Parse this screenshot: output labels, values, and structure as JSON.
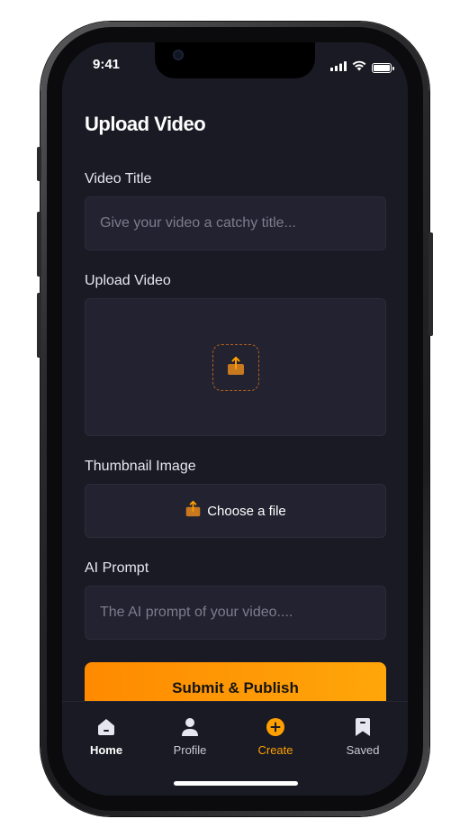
{
  "status_bar": {
    "time": "9:41",
    "signal_icon": "signal-bars-icon",
    "wifi_icon": "wifi-icon",
    "battery_icon": "battery-icon"
  },
  "page": {
    "title": "Upload Video"
  },
  "form": {
    "video_title": {
      "label": "Video Title",
      "placeholder": "Give your video a catchy title..."
    },
    "upload_video": {
      "label": "Upload Video",
      "icon": "upload-icon"
    },
    "thumbnail": {
      "label": "Thumbnail Image",
      "button_label": "Choose a file",
      "icon": "upload-icon"
    },
    "ai_prompt": {
      "label": "AI Prompt",
      "placeholder": "The AI prompt of your video...."
    },
    "submit_label": "Submit & Publish"
  },
  "tabs": [
    {
      "label": "Home",
      "icon": "home-icon",
      "active": false
    },
    {
      "label": "Profile",
      "icon": "profile-icon",
      "active": false
    },
    {
      "label": "Create",
      "icon": "plus-circle-icon",
      "active": true
    },
    {
      "label": "Saved",
      "icon": "bookmark-icon",
      "active": false
    }
  ],
  "colors": {
    "accent": "#ffa000",
    "background": "#1a1a24",
    "field_background": "#222230"
  }
}
